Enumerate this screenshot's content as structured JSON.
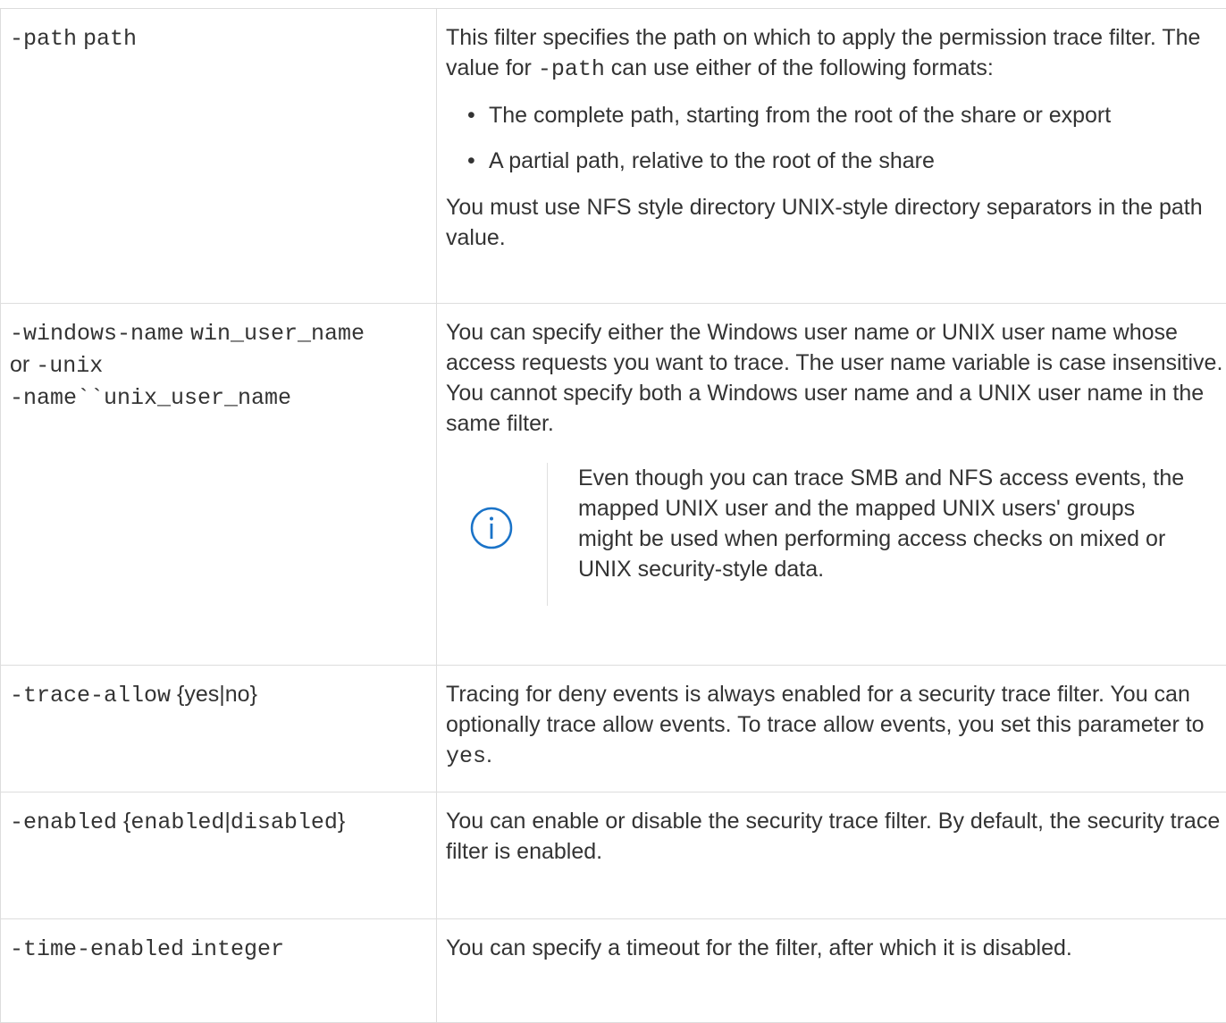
{
  "colors": {
    "border": "#dddddd",
    "text": "#333333",
    "note_icon": "#1a73c8"
  },
  "rows": {
    "path": {
      "param_flag": "-path",
      "param_value": "path",
      "desc_intro_before": "This filter specifies the path on which to apply the permission trace filter. The value for ",
      "desc_intro_code": "-path",
      "desc_intro_after": " can use either of the following formats:",
      "bullets": [
        "The complete path, starting from the root of the share or export",
        "A partial path, relative to the root of the share"
      ],
      "desc_outro": "You must use NFS style directory UNIX-style directory separators in the path value."
    },
    "name": {
      "param_flag1": "-windows-name",
      "param_value1": "win_user_name",
      "param_or": "or",
      "param_flag2": "-unix",
      "param_line3": "-name``unix_user_name",
      "desc": "You can specify either the Windows user name or UNIX user name whose access requests you want to trace. The user name variable is case insensitive. You cannot specify both a Windows user name and a UNIX user name in the same filter.",
      "note_icon": "info-circle-icon",
      "note_text": "Even though you can trace SMB and NFS access events, the mapped UNIX user and the mapped UNIX users' groups might be used when performing access checks on mixed or UNIX security-style data."
    },
    "allow": {
      "param_flag": "-trace-allow",
      "param_brace_open": "{",
      "param_opt1": "yes",
      "param_sep": "|",
      "param_opt2": "no",
      "param_brace_close": "}",
      "desc_before": "Tracing for deny events is always enabled for a security trace filter. You can optionally trace allow events. To trace allow events, you set this parameter to ",
      "desc_code": "yes",
      "desc_after": "."
    },
    "enabled": {
      "param_flag": "-enabled",
      "param_brace_open": "{",
      "param_opt1": "enabled",
      "param_sep": "|",
      "param_opt2": "disabled",
      "param_brace_close": "}",
      "desc": "You can enable or disable the security trace filter. By default, the security trace filter is enabled."
    },
    "time": {
      "param_flag": "-time-enabled",
      "param_value": "integer",
      "desc": "You can specify a timeout for the filter, after which it is disabled."
    }
  }
}
